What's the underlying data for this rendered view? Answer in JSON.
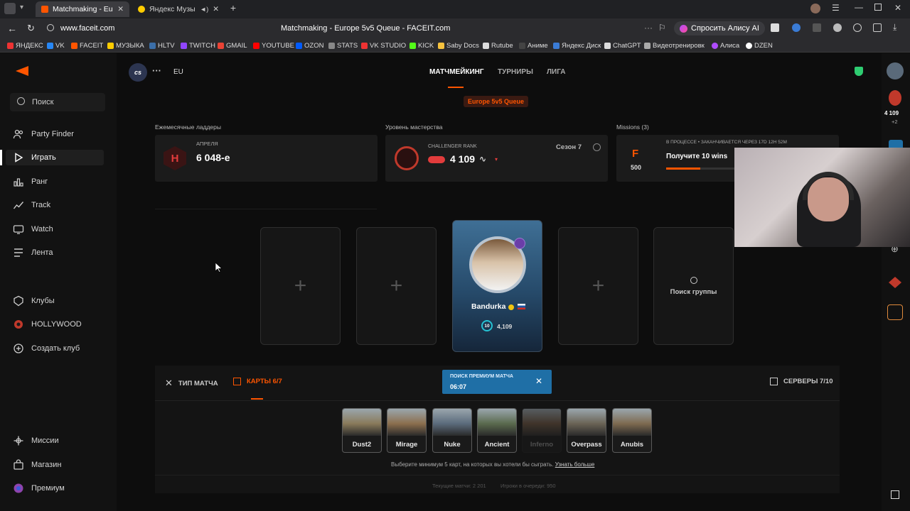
{
  "browser": {
    "tabs": [
      {
        "title": "Matchmaking - Europe",
        "active": true
      },
      {
        "title": "Яндекс Музыка — с",
        "active": false
      }
    ],
    "url": "www.faceit.com",
    "page_title": "Matchmaking - Europe 5v5 Queue - FACEIT.com",
    "alice_label": "Спросить Алису AI",
    "bookmarks": [
      "ЯНДЕКС",
      "VK",
      "FACEIT",
      "МУЗЫКА",
      "HLTV",
      "TWITCH",
      "GMAIL",
      "YOUTUBE",
      "OZON",
      "STATS",
      "VK STUDIO",
      "KICK",
      "Saby Docs",
      "Rutube",
      "Аниме",
      "Яндекс Диск",
      "ChatGPT",
      "Видеотренировк",
      "Алиса",
      "DZEN"
    ]
  },
  "sidebar": {
    "search": "Поиск",
    "items": [
      {
        "label": "Party Finder",
        "icon": "users-icon"
      },
      {
        "label": "Играть",
        "icon": "play-icon",
        "active": true
      },
      {
        "label": "Ранг",
        "icon": "rank-icon"
      },
      {
        "label": "Track",
        "icon": "chart-icon"
      },
      {
        "label": "Watch",
        "icon": "tv-icon"
      },
      {
        "label": "Лента",
        "icon": "feed-icon"
      }
    ],
    "club_items": [
      {
        "label": "Клубы",
        "icon": "clubs-icon"
      },
      {
        "label": "HOLLYWOOD",
        "icon": "hollywood-icon"
      },
      {
        "label": "Создать клуб",
        "icon": "plus-circle-icon"
      }
    ],
    "bottom_items": [
      {
        "label": "Миссии",
        "icon": "missions-icon"
      },
      {
        "label": "Магазин",
        "icon": "store-icon"
      },
      {
        "label": "Премиум",
        "icon": "premium-icon"
      }
    ]
  },
  "header": {
    "game_badge": "cs",
    "region": "EU",
    "tabs": [
      "МАТЧМЕЙКИНГ",
      "ТУРНИРЫ",
      "ЛИГА"
    ],
    "queue_badge": "Europe 5v5 Queue"
  },
  "ladder": {
    "section": "Ежемесячные ладдеры",
    "sub": "Апреля",
    "value": "6 048-е"
  },
  "mastery": {
    "section": "Уровень мастерства",
    "sub": "CHALLENGER RANK",
    "elo": "4 109",
    "season": "Сезон 7"
  },
  "missions": {
    "section": "Missions (3)",
    "status": "В ПРОЦЕССЕ • ЗАКАНЧИВАЕТСЯ ЧЕРЕЗ 17D 12H 52M",
    "title": "Получите 10 wins",
    "points": "500",
    "progress": 0.3
  },
  "lobby": {
    "player_name": "Bandurka",
    "player_level": "10",
    "player_elo": "4,109",
    "find_group": "Поиск группы"
  },
  "bottom_bar": {
    "match_type": "ТИП МАТЧА",
    "maps_tab": "КАРТЫ 6/7",
    "servers": "СЕРВЕРЫ 7/10",
    "search_title": "ПОИСК ПРЕМИУМ МАТЧА",
    "search_time": "06:07"
  },
  "maps": [
    {
      "name": "Dust2",
      "selected": true,
      "color": "#8a7a5a"
    },
    {
      "name": "Mirage",
      "selected": true,
      "color": "#8c6f4e"
    },
    {
      "name": "Nuke",
      "selected": true,
      "color": "#5b6b7c"
    },
    {
      "name": "Ancient",
      "selected": true,
      "color": "#5a6a4e"
    },
    {
      "name": "Inferno",
      "selected": false,
      "color": "#6b5440"
    },
    {
      "name": "Overpass",
      "selected": true,
      "color": "#6a6355"
    },
    {
      "name": "Anubis",
      "selected": true,
      "color": "#7e6a50"
    }
  ],
  "maps_hint": "Выберите минимум 5 карт, на которых вы хотели бы сыграть.",
  "maps_link": "Узнать больше",
  "footer": {
    "current_matches": "Текущие матчи: 2 201",
    "queue_players": "Игроки в очереди: 950"
  },
  "rightbar": {
    "elo": "4 109",
    "delta": "+2"
  },
  "colors": {
    "accent": "#ff5500",
    "queue_blue": "#1f6fa6"
  }
}
